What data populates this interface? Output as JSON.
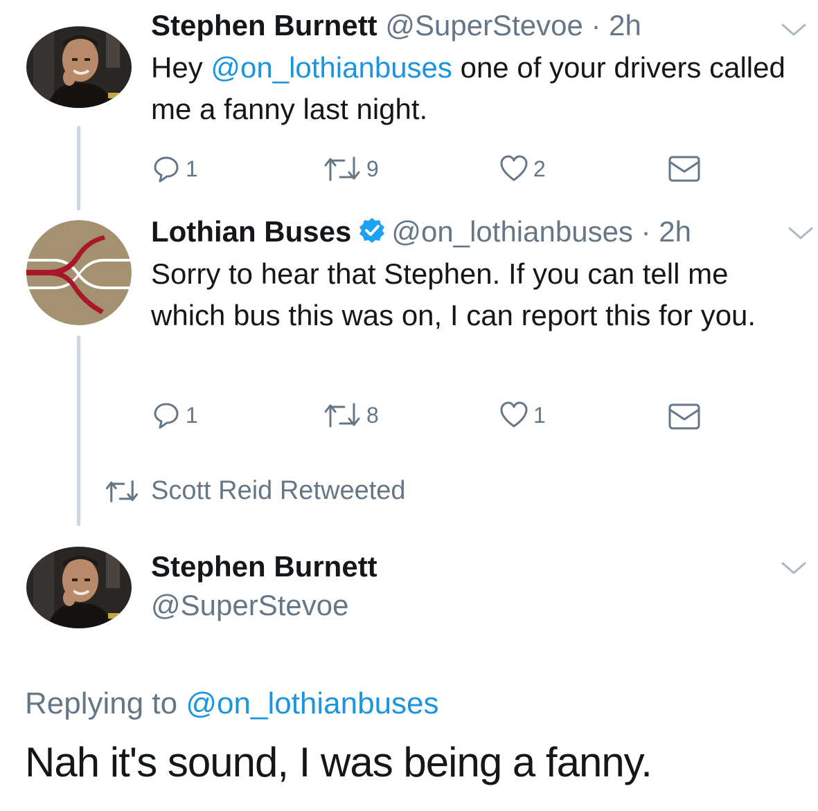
{
  "tweets": [
    {
      "name": "Stephen Burnett",
      "handle": "@SuperStevoe",
      "sep": " · ",
      "time": "2h",
      "text_prefix": "Hey ",
      "mention": "@on_lothianbuses",
      "text_suffix": " one of your drivers called me a fanny last night.",
      "replies": "1",
      "retweets": "9",
      "likes": "2"
    },
    {
      "name": "Lothian Buses",
      "handle": "@on_lothianbuses",
      "sep": " · ",
      "time": "2h",
      "text": "Sorry to hear that Stephen. If you can tell me which bus this was on, I can report this for you.",
      "replies": "1",
      "retweets": "8",
      "likes": "1"
    }
  ],
  "retweeted_by": "Scott Reid Retweeted",
  "main_tweet": {
    "name": "Stephen Burnett",
    "handle": "@SuperStevoe",
    "replying_label": "Replying to ",
    "replying_to": "@on_lothianbuses",
    "text": "Nah it's sound, I was being a fanny."
  },
  "icons": {
    "reply": "reply-icon",
    "retweet": "retweet-icon",
    "like": "heart-icon",
    "dm": "envelope-icon",
    "more": "chevron-down-icon",
    "verified": "verified-badge-icon"
  },
  "colors": {
    "text": "#14171a",
    "secondary": "#657786",
    "link": "#1b95e0",
    "thread_line": "#ccd6dd",
    "lothian_gold": "#a4916f",
    "lothian_red": "#a8182a"
  }
}
